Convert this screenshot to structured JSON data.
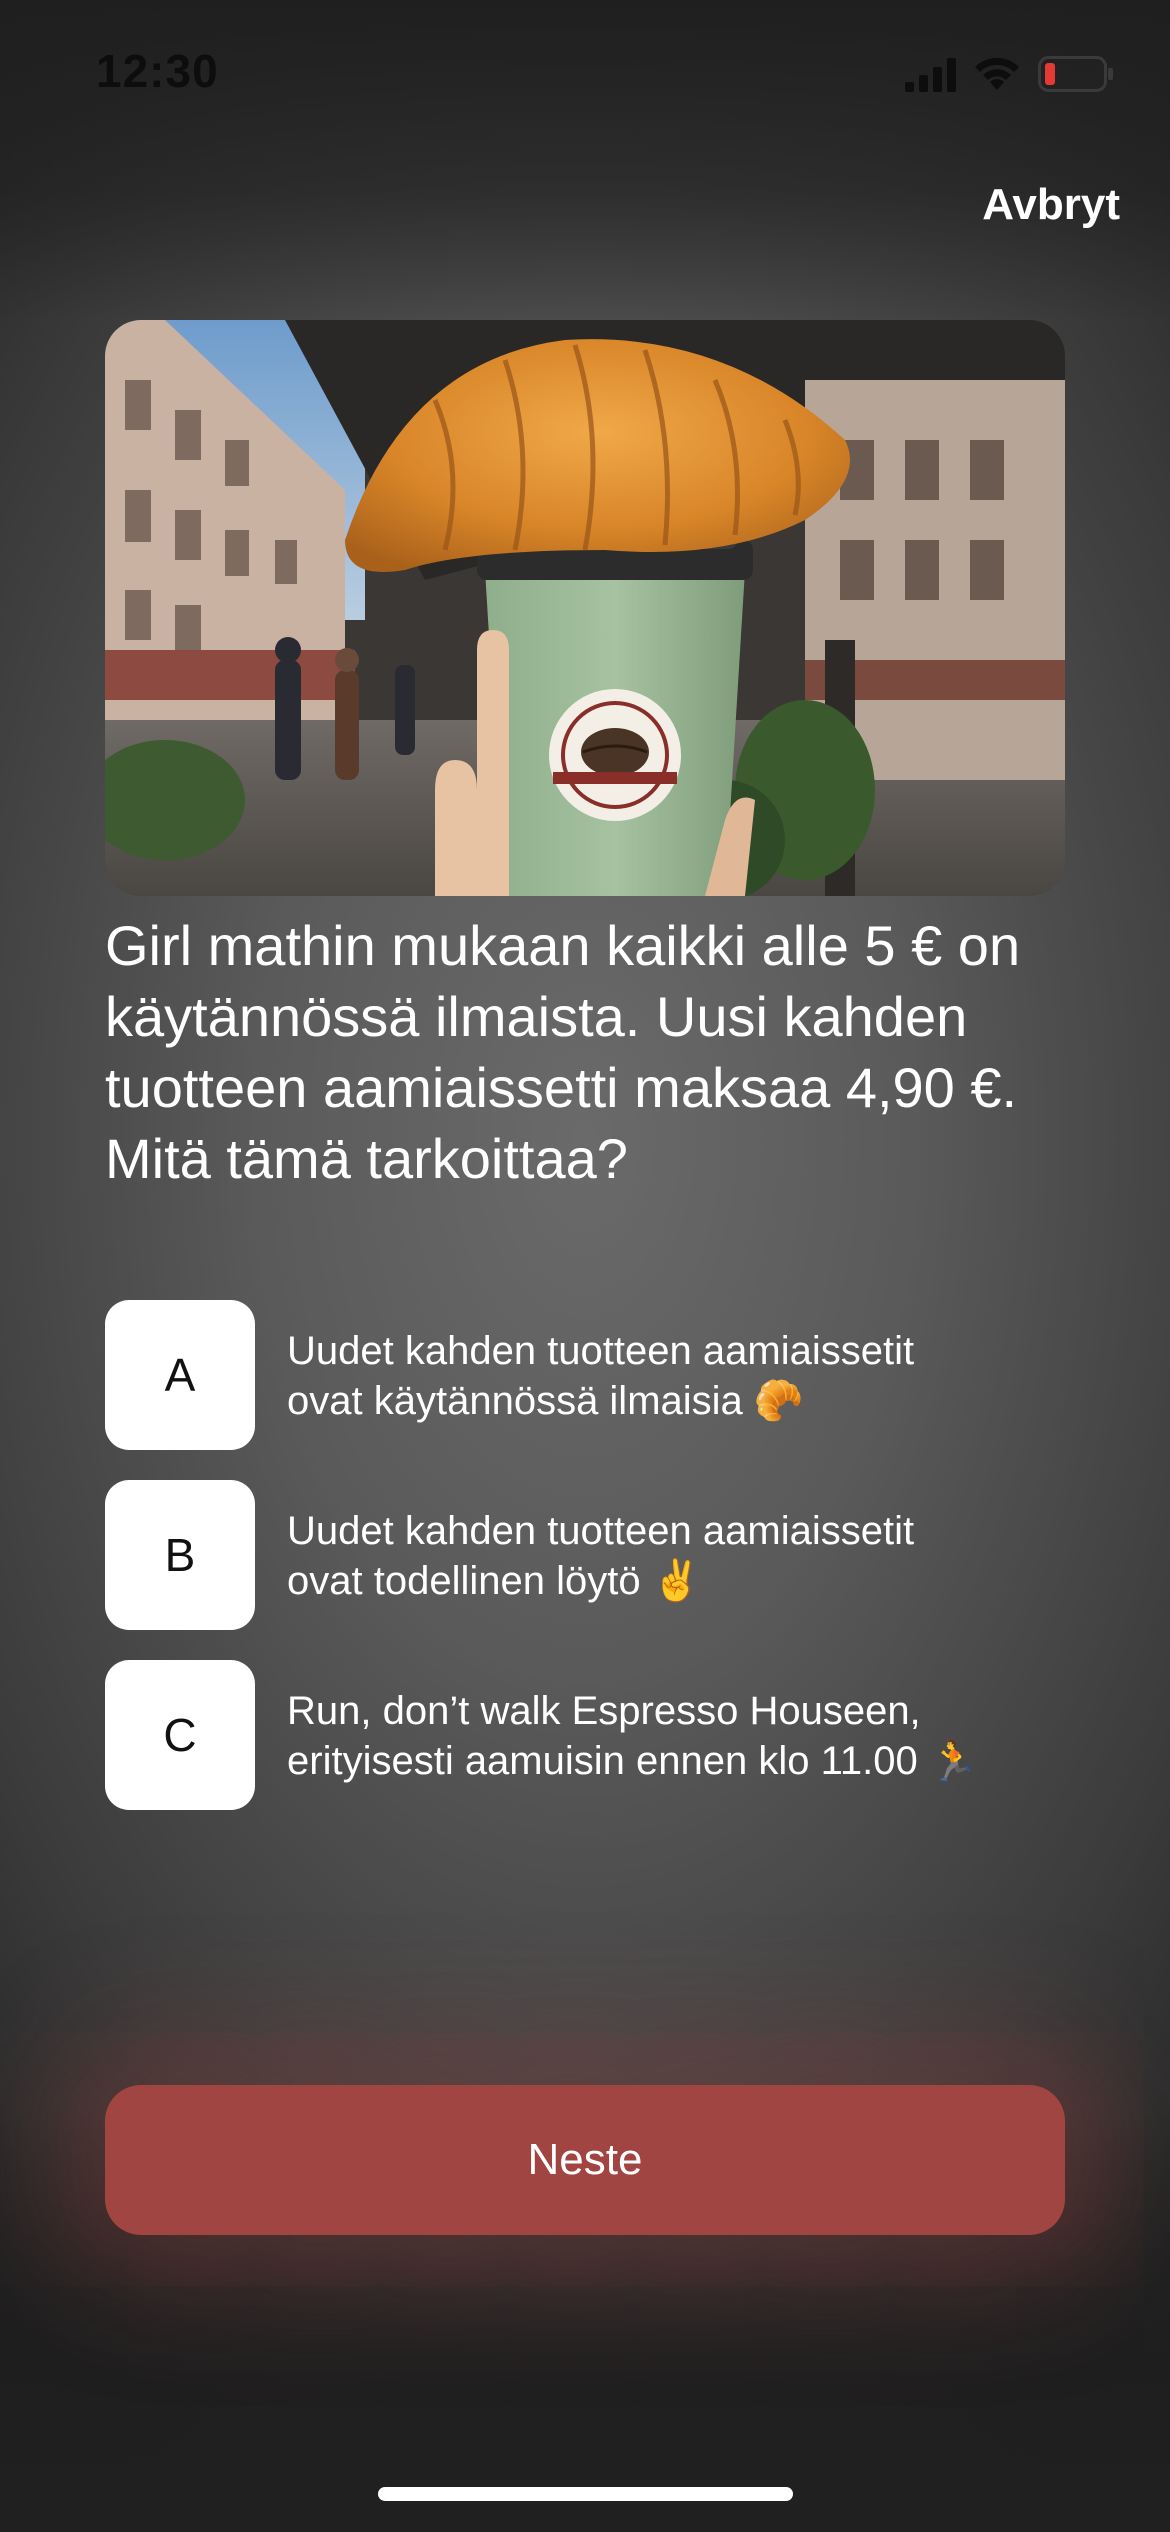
{
  "status_bar": {
    "time": "12:30"
  },
  "header": {
    "cancel_label": "Avbryt"
  },
  "hero": {
    "icon": "croissant-coffee-photo"
  },
  "question": {
    "text": "Girl mathin mukaan kaikki alle 5 € on käytännössä ilmaista. Uusi kahden tuotteen aamiaissetti maksaa 4,90 €. Mitä tämä tarkoittaa?"
  },
  "options": [
    {
      "key": "A",
      "text": "Uudet kahden tuotteen aamiaissetit\novat käytännössä ilmaisia 🥐"
    },
    {
      "key": "B",
      "text": "Uudet kahden tuotteen aamiaissetit\novat todellinen löytö ✌️"
    },
    {
      "key": "C",
      "text": "Run, don’t walk Espresso Houseen,\nerityisesti aamuisin ennen klo 11.00 🏃"
    }
  ],
  "footer": {
    "next_label": "Neste"
  },
  "colors": {
    "accent": "#a14542",
    "battery_low": "#e53935"
  }
}
